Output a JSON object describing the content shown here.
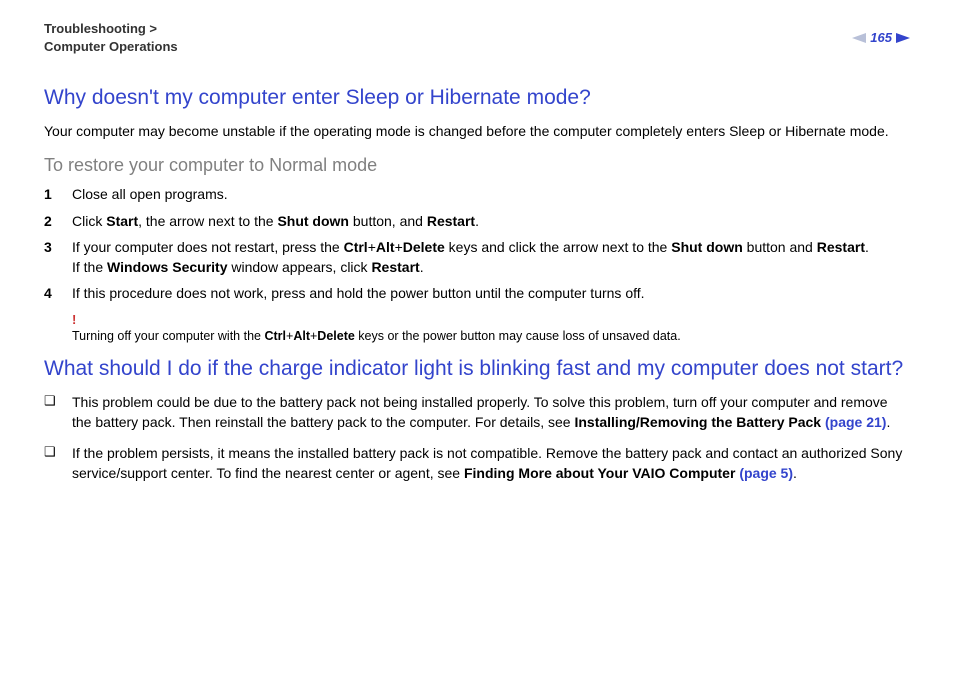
{
  "header": {
    "breadcrumb_line1": "Troubleshooting >",
    "breadcrumb_line2": "Computer Operations",
    "page_number": "165"
  },
  "section1": {
    "heading": "Why doesn't my computer enter Sleep or Hibernate mode?",
    "intro": "Your computer may become unstable if the operating mode is changed before the computer completely enters Sleep or Hibernate mode.",
    "subheading": "To restore your computer to Normal mode",
    "steps": [
      {
        "n": "1",
        "text": "Close all open programs."
      },
      {
        "n": "2",
        "prefix": "Click ",
        "b1": "Start",
        "mid1": ", the arrow next to the ",
        "b2": "Shut down",
        "mid2": " button, and ",
        "b3": "Restart",
        "suffix": "."
      },
      {
        "n": "3",
        "prefix": "If your computer does not restart, press the ",
        "b1": "Ctrl",
        "plus1": "+",
        "b2": "Alt",
        "plus2": "+",
        "b3": "Delete",
        "mid1": " keys and click the arrow next to the ",
        "b4": "Shut down",
        "mid2": " button and ",
        "b5": "Restart",
        "suffix1": ".",
        "line2_prefix": "If the ",
        "line2_b1": "Windows Security",
        "line2_mid": " window appears, click ",
        "line2_b2": "Restart",
        "line2_suffix": "."
      },
      {
        "n": "4",
        "text": "If this procedure does not work, press and hold the power button until the computer turns off."
      }
    ],
    "warning": {
      "bang": "!",
      "prefix": "Turning off your computer with the ",
      "b1": "Ctrl",
      "plus1": "+",
      "b2": "Alt",
      "plus2": "+",
      "b3": "Delete",
      "suffix": " keys or the power button may cause loss of unsaved data."
    }
  },
  "section2": {
    "heading": "What should I do if the charge indicator light is blinking fast and my computer does not start?",
    "bullets": [
      {
        "prefix": "This problem could be due to the battery pack not being installed properly. To solve this problem, turn off your computer and remove the battery pack. Then reinstall the battery pack to the computer. For details, see ",
        "b1": "Installing/Removing the Battery Pack ",
        "link": "(page 21)",
        "suffix": "."
      },
      {
        "prefix": "If the problem persists, it means the installed battery pack is not compatible. Remove the battery pack and contact an authorized Sony service/support center. To find the nearest center or agent, see ",
        "b1": "Finding More about Your VAIO Computer ",
        "link": "(page 5)",
        "suffix": "."
      }
    ]
  }
}
